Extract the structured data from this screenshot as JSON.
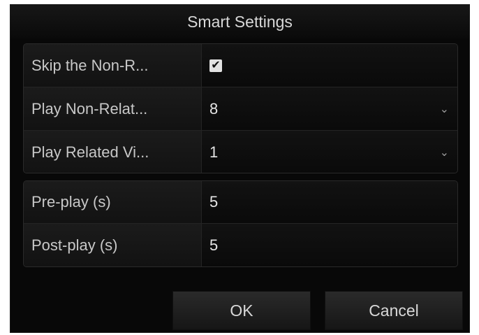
{
  "dialog": {
    "title": "Smart Settings"
  },
  "settings": [
    {
      "label": "Skip the Non-R...",
      "type": "checkbox",
      "checked": true,
      "value": "✔"
    },
    {
      "label": "Play Non-Relat...",
      "type": "select",
      "value": "8"
    },
    {
      "label": "Play Related Vi...",
      "type": "select",
      "value": "1"
    }
  ],
  "timing": [
    {
      "label": "Pre-play (s)",
      "value": "5"
    },
    {
      "label": "Post-play (s)",
      "value": "5"
    }
  ],
  "buttons": {
    "ok_label": "OK",
    "cancel_label": "Cancel"
  },
  "icons": {
    "checkbox": "checkmark-icon",
    "dropdown": "chevron-down-icon"
  }
}
